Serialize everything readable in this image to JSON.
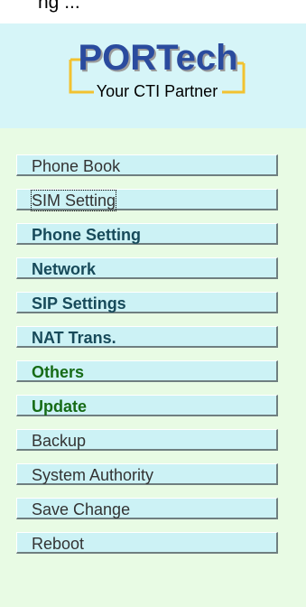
{
  "top_fragment": "ng ...",
  "logo": {
    "brand": "PORTech",
    "tagline": "Your CTI Partner",
    "colors": {
      "brand": "#2a4b9e",
      "bracket": "#f2c230",
      "shadow": "#9b9b9b"
    }
  },
  "menu": {
    "items": [
      {
        "label": "Phone Book"
      },
      {
        "label": "SIM Setting"
      },
      {
        "label": "Phone Setting"
      },
      {
        "label": "Network"
      },
      {
        "label": "SIP Settings"
      },
      {
        "label": "NAT Trans."
      },
      {
        "label": "Others"
      },
      {
        "label": "Update"
      },
      {
        "label": "Backup"
      },
      {
        "label": "System Authority"
      },
      {
        "label": "Save Change"
      },
      {
        "label": "Reboot"
      }
    ]
  }
}
